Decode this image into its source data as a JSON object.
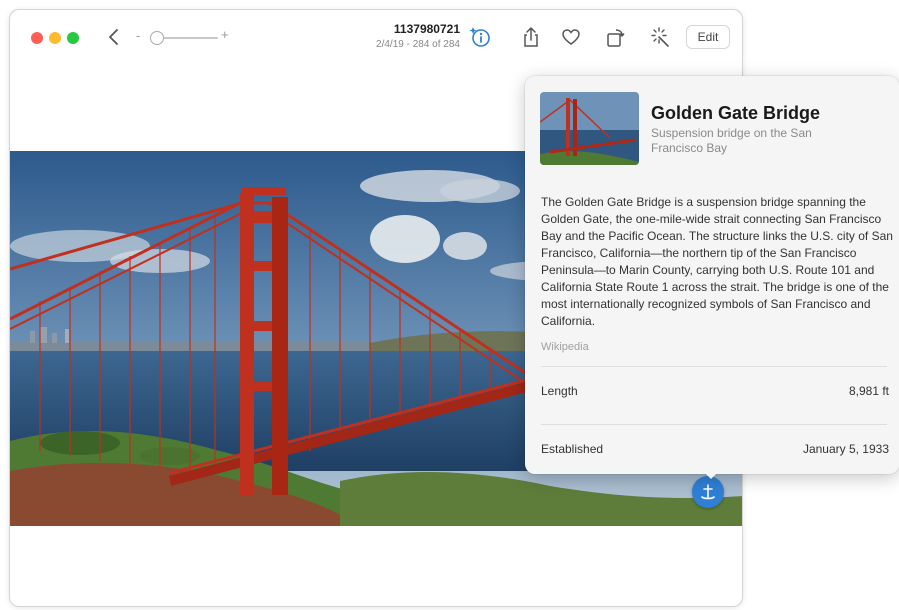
{
  "toolbar": {
    "photo_title": "1137980721",
    "photo_meta": "2/4/19  -  284 of 284",
    "zoom_minus": "-",
    "zoom_plus": "+",
    "edit_label": "Edit",
    "icons": [
      "back-icon",
      "info-icon",
      "share-icon",
      "heart-icon",
      "rotate-icon",
      "magic-wand-icon"
    ]
  },
  "lookup": {
    "title": "Golden Gate Bridge",
    "subtitle": "Suspension bridge on the San Francisco Bay",
    "description": "The Golden Gate Bridge is a suspension bridge spanning the Golden Gate, the one-mile-wide strait connecting San Francisco Bay and the Pacific Ocean. The structure links the U.S. city of San Francisco, California—the northern tip of the San Francisco Peninsula—to Marin County, carrying both U.S. Route 101 and California State Route 1 across the strait. The bridge is one of the most internationally recognized symbols of San Francisco and California.",
    "source": "Wikipedia",
    "facts": [
      {
        "label": "Length",
        "value": "8,981 ft"
      },
      {
        "label": "Established",
        "value": "January 5, 1933"
      }
    ]
  },
  "colors": {
    "accent": "#2f7fd6",
    "bridge": "#c0301e",
    "close": "#ff5f57",
    "minimize": "#febc2e",
    "zoom": "#28c840"
  }
}
